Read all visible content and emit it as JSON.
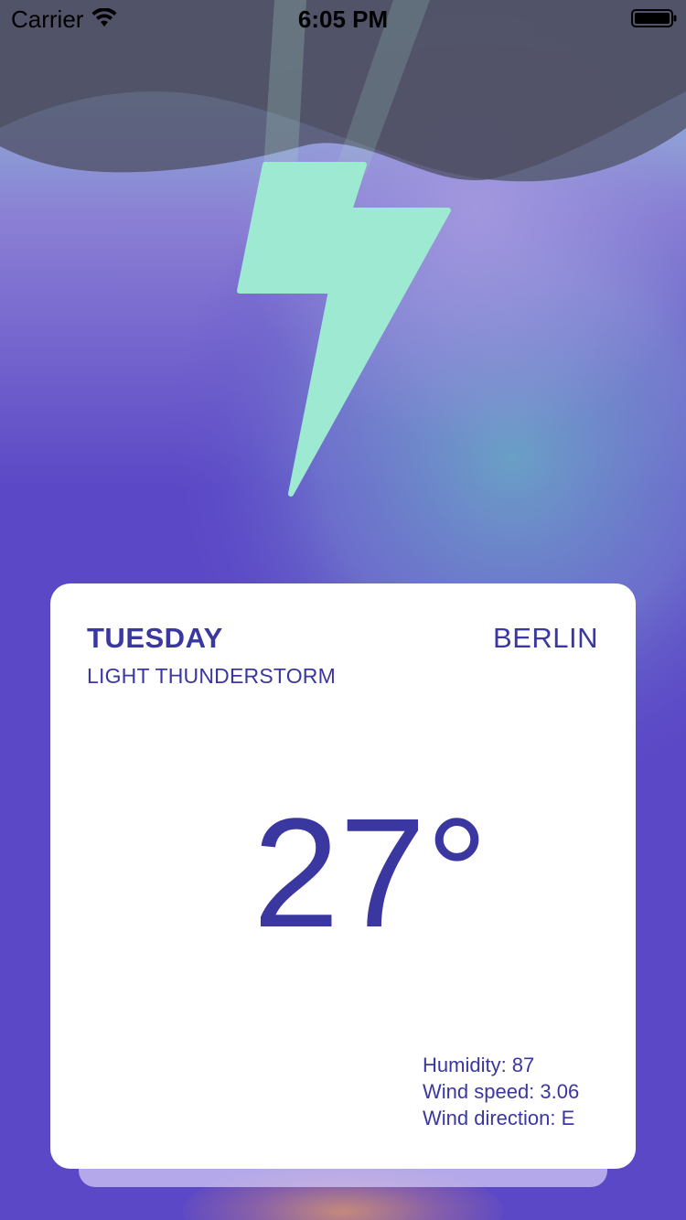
{
  "status_bar": {
    "carrier": "Carrier",
    "time": "6:05 PM"
  },
  "icons": {
    "wifi": "wifi-icon",
    "battery": "battery-icon",
    "weather": "lightning-bolt-icon"
  },
  "colors": {
    "background": "#5b48c6",
    "accent_text": "#3a37a0",
    "bolt": "#9ee9d2",
    "card": "#ffffff"
  },
  "weather": {
    "day": "TUESDAY",
    "condition": "LIGHT THUNDERSTORM",
    "city": "BERLIN",
    "temperature": "27°",
    "humidity": "Humidity: 87",
    "wind_speed": "Wind speed: 3.06",
    "wind_direction": "Wind direction: E"
  }
}
